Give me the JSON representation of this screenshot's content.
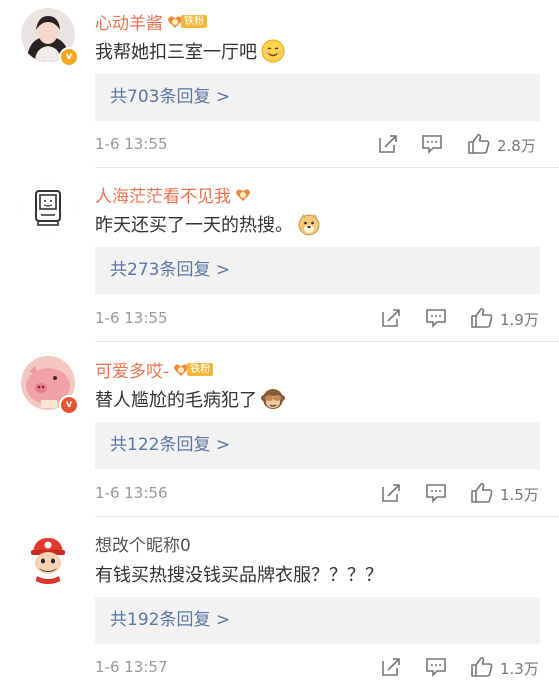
{
  "comments": [
    {
      "name": "心动羊酱",
      "fan_badge": "铁粉",
      "text": "我帮她扣三室一厅吧",
      "emoji": "smile-emoji",
      "replies": "共703条回复 >",
      "time": "1-6 13:55",
      "likes": "2.8万"
    },
    {
      "name": "人海茫茫看不见我",
      "fan_badge": "",
      "text": "昨天还买了一天的热搜。",
      "emoji": "doge-emoji",
      "replies": "共273条回复 >",
      "time": "1-6 13:55",
      "likes": "1.9万"
    },
    {
      "name": "可爱多哎-",
      "fan_badge": "铁粉",
      "text": "替人尴尬的毛病犯了",
      "emoji": "see-no-evil-monkey-emoji",
      "replies": "共122条回复 >",
      "time": "1-6 13:56",
      "likes": "1.5万"
    },
    {
      "name": "想改个昵称0",
      "fan_badge": "",
      "text": "有钱买热搜没钱买品牌衣服？？？？",
      "emoji": "",
      "replies": "共192条回复 >",
      "time": "1-6 13:57",
      "likes": "1.3万"
    }
  ],
  "colors": {
    "name_highlight": "#eb7350",
    "name_plain": "#555555",
    "link": "#5b76a7",
    "reply_bg": "#f2f2f2",
    "verified_badge": "#f6a623"
  }
}
